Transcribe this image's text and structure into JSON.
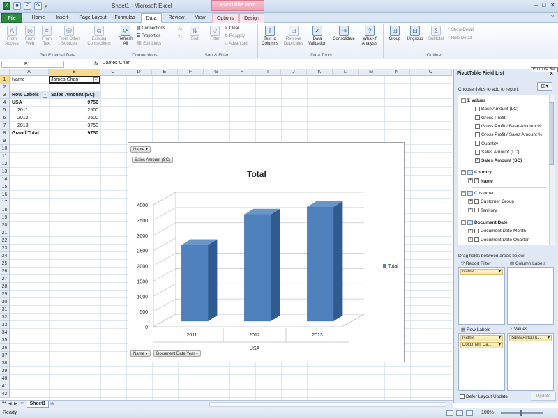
{
  "titlebar": {
    "title": "Sheet1 - Microsoft Excel",
    "context_group": "PivotTable Tools",
    "qat_icons": [
      "excel-logo-icon",
      "save-icon",
      "undo-icon",
      "redo-icon"
    ]
  },
  "tabs": [
    {
      "label": "File"
    },
    {
      "label": "Home"
    },
    {
      "label": "Insert"
    },
    {
      "label": "Page Layout"
    },
    {
      "label": "Formulas"
    },
    {
      "label": "Data"
    },
    {
      "label": "Review"
    },
    {
      "label": "View"
    },
    {
      "label": "Options"
    },
    {
      "label": "Design"
    }
  ],
  "ribbon": {
    "get_external": {
      "label": "Get External Data",
      "buttons": [
        {
          "label": "From Access"
        },
        {
          "label": "From Web"
        },
        {
          "label": "From Text"
        },
        {
          "label": "From Other Sources"
        },
        {
          "label": "Existing Connections"
        }
      ]
    },
    "connections": {
      "label": "Connections",
      "refresh": "Refresh All",
      "small": [
        "Connections",
        "Properties",
        "Edit Links"
      ]
    },
    "sort_filter": {
      "label": "Sort & Filter",
      "sort": "Sort",
      "filter": "Filter",
      "small": [
        "Clear",
        "Reapply",
        "Advanced"
      ]
    },
    "data_tools": {
      "label": "Data Tools",
      "buttons": [
        {
          "label": "Text to Columns"
        },
        {
          "label": "Remove Duplicates"
        },
        {
          "label": "Data Validation"
        },
        {
          "label": "Consolidate"
        },
        {
          "label": "What-If Analysis"
        }
      ]
    },
    "outline": {
      "label": "Outline",
      "buttons": [
        {
          "label": "Group"
        },
        {
          "label": "Ungroup"
        },
        {
          "label": "Subtotal"
        }
      ],
      "small": [
        "Show Detail",
        "Hide Detail"
      ]
    }
  },
  "formula_bar": {
    "name_box": "B1",
    "fx": "fx",
    "value": "James Chan",
    "tooltip": "Formula Bar"
  },
  "columns": [
    "A",
    "B",
    "C",
    "D",
    "E",
    "F",
    "G",
    "H",
    "I",
    "J",
    "K",
    "L",
    "M",
    "N",
    "O"
  ],
  "rows": [
    "1",
    "2",
    "3",
    "4",
    "5",
    "6",
    "7",
    "8",
    "9",
    "10",
    "11",
    "12",
    "13",
    "14",
    "15",
    "16",
    "17",
    "18",
    "19",
    "20",
    "21",
    "22",
    "23",
    "24",
    "25",
    "26",
    "27",
    "28",
    "29",
    "30",
    "31",
    "32",
    "33",
    "34",
    "35",
    "36",
    "37",
    "38",
    "39",
    "40",
    "41",
    "42"
  ],
  "cells": {
    "a1": "Name",
    "b1": "James Chan",
    "a3": "Row Labels",
    "b3": "Sales Amount (SC)",
    "a4": "USA",
    "b4": "9750",
    "a5": "2011",
    "b5": "2500",
    "a6": "2012",
    "b6": "3500",
    "a7": "2013",
    "b7": "3750",
    "a8": "Grand Total",
    "b8": "9750"
  },
  "chart": {
    "filter_button": "Name",
    "value_button": "Sales Amount (SC)",
    "axis_buttons": [
      "Name",
      "Document Date Year"
    ]
  },
  "chart_data": {
    "type": "bar",
    "title": "Total",
    "categories": [
      "2011",
      "2012",
      "2013"
    ],
    "category_group": "USA",
    "series": [
      {
        "name": "Total",
        "values": [
          2500,
          3500,
          3750
        ],
        "color": "#4f81bd"
      }
    ],
    "yticks": [
      "0",
      "500",
      "1000",
      "1500",
      "2000",
      "2500",
      "3000",
      "3500",
      "4000"
    ],
    "ylim": [
      0,
      4000
    ],
    "grid": true,
    "legend": "right",
    "three_d": true
  },
  "field_list": {
    "title": "PivotTable Field List",
    "choose_label": "Choose fields to add to report:",
    "groups": [
      {
        "name": "Values",
        "fields": [
          {
            "label": "Base Amount (LC)",
            "checked": false
          },
          {
            "label": "Gross Profit",
            "checked": false
          },
          {
            "label": "Gross Profit / Base Amount %",
            "checked": false
          },
          {
            "label": "Gross Profit / Sales Amount %",
            "checked": false
          },
          {
            "label": "Quantity",
            "checked": false
          },
          {
            "label": "Sales Amount (LC)",
            "checked": false
          },
          {
            "label": "Sales Amount (SC)",
            "checked": true
          }
        ]
      },
      {
        "name": "Country",
        "fields": [
          {
            "label": "Name",
            "checked": true
          }
        ]
      },
      {
        "name": "Customer",
        "fields": [
          {
            "label": "Customer Group",
            "checked": false
          },
          {
            "label": "Territory",
            "checked": false
          }
        ]
      },
      {
        "name": "Document Date",
        "fields": [
          {
            "label": "Document Date Month",
            "checked": false
          },
          {
            "label": "Document Date Quarter",
            "checked": false
          }
        ]
      }
    ],
    "drag_label": "Drag fields between areas below:",
    "areas": {
      "report_filter": {
        "label": "Report Filter",
        "items": [
          "Name"
        ]
      },
      "column_labels": {
        "label": "Column Labels",
        "items": []
      },
      "row_labels": {
        "label": "Row Labels",
        "items": [
          "Name",
          "Document Da..."
        ]
      },
      "values": {
        "label": "Values",
        "items": [
          "Sales Amount..."
        ]
      }
    },
    "defer_label": "Defer Layout Update",
    "update_label": "Update"
  },
  "sheet_tabs": {
    "active": "Sheet1"
  },
  "status": {
    "ready": "Ready",
    "zoom": "100%"
  }
}
